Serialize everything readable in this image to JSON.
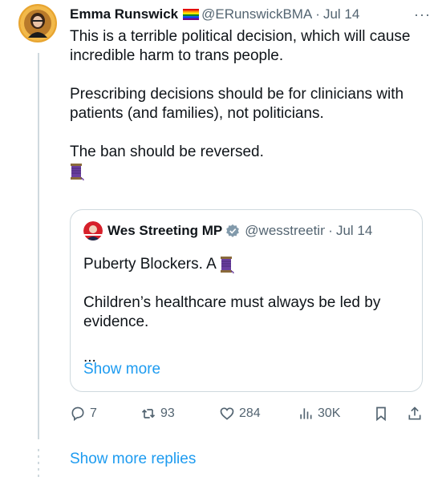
{
  "tweet": {
    "author": "Emma Runswick",
    "handle": "@ERunswickBMA",
    "separator": "·",
    "date": "Jul 14",
    "paragraphs": [
      "This is a terrible political decision, which will cause incredible harm to trans people.",
      "Prescribing decisions should be for clinicians with patients (and families), not politicians.",
      "The ban should be reversed."
    ],
    "more_label": "···"
  },
  "quote": {
    "author": "Wes Streeting MP",
    "handle": "@wesstreeting",
    "separator": "·",
    "date": "Jul 14",
    "line1": "Puberty Blockers. A",
    "line2": "Children’s healthcare must always be led by evidence.",
    "ellipsis": "...",
    "show_more": "Show more"
  },
  "actions": {
    "replies": "7",
    "reposts": "93",
    "likes": "284",
    "views": "30K"
  },
  "show_more_replies": "Show more replies",
  "colors": {
    "link": "#1d9bf0",
    "muted": "#536471",
    "border": "#cfd9de",
    "spool": "#6a3fa0"
  },
  "icons": [
    "rainbow-flag-icon",
    "spool-icon",
    "verified-badge-icon",
    "reply-icon",
    "repost-icon",
    "like-icon",
    "views-icon",
    "bookmark-icon",
    "share-icon",
    "more-options-icon"
  ]
}
